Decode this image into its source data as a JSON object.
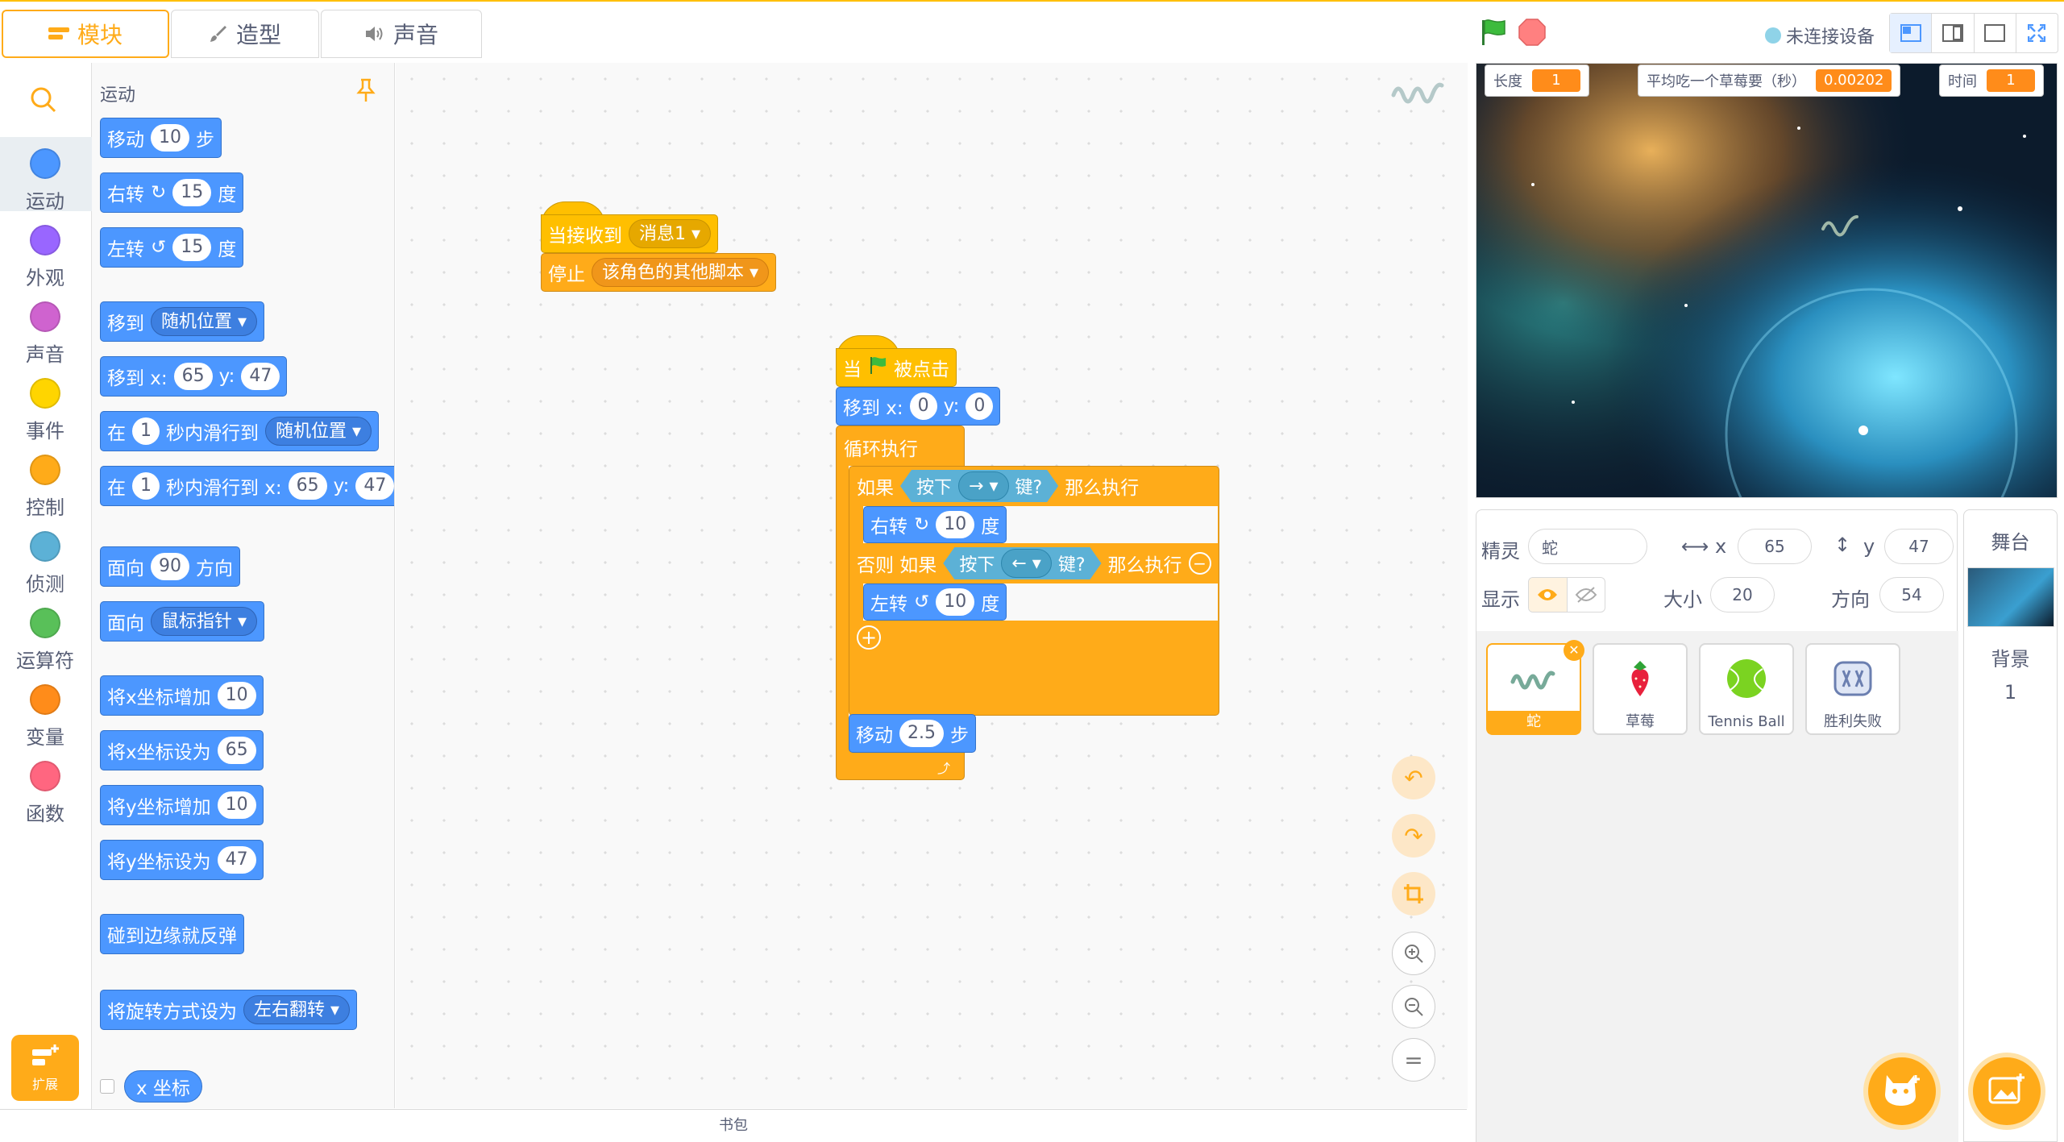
{
  "tabs": [
    {
      "label": "模块",
      "icon": "blocks-icon"
    },
    {
      "label": "造型",
      "icon": "brush-icon"
    },
    {
      "label": "声音",
      "icon": "speaker-icon"
    }
  ],
  "device_status": "未连接设备",
  "categories": [
    {
      "label": "运动",
      "color": "#4c97ff"
    },
    {
      "label": "外观",
      "color": "#9966ff"
    },
    {
      "label": "声音",
      "color": "#cf63cf"
    },
    {
      "label": "事件",
      "color": "#ffd500"
    },
    {
      "label": "控制",
      "color": "#ffab19"
    },
    {
      "label": "侦测",
      "color": "#5cb1d6"
    },
    {
      "label": "运算符",
      "color": "#59c059"
    },
    {
      "label": "变量",
      "color": "#ff8c1a"
    },
    {
      "label": "函数",
      "color": "#ff6680"
    }
  ],
  "extension_label": "扩展",
  "palette": {
    "section_title": "运动",
    "move": {
      "a": "移动",
      "n": "10",
      "b": "步"
    },
    "turn_right": {
      "a": "右转",
      "n": "15",
      "b": "度"
    },
    "turn_left": {
      "a": "左转",
      "n": "15",
      "b": "度"
    },
    "goto": {
      "a": "移到",
      "dd": "随机位置"
    },
    "goto_xy": {
      "a": "移到 x:",
      "x": "65",
      "b": "y:",
      "y": "47"
    },
    "glide": {
      "a": "在",
      "n": "1",
      "b": "秒内滑行到",
      "dd": "随机位置"
    },
    "glide_xy": {
      "a": "在",
      "n": "1",
      "b": "秒内滑行到 x:",
      "x": "65",
      "c": "y:",
      "y": "47"
    },
    "point_dir": {
      "a": "面向",
      "n": "90",
      "b": "方向"
    },
    "point_towards": {
      "a": "面向",
      "dd": "鼠标指针"
    },
    "change_x": {
      "a": "将x坐标增加",
      "n": "10"
    },
    "set_x": {
      "a": "将x坐标设为",
      "n": "65"
    },
    "change_y": {
      "a": "将y坐标增加",
      "n": "10"
    },
    "set_y": {
      "a": "将y坐标设为",
      "n": "47"
    },
    "bounce": "碰到边缘就反弹",
    "rotation": {
      "a": "将旋转方式设为",
      "dd": "左右翻转"
    },
    "xpos": "x 坐标"
  },
  "script1": {
    "hat": {
      "a": "当接收到",
      "dd": "消息1"
    },
    "stop": {
      "a": "停止",
      "dd": "该角色的其他脚本"
    }
  },
  "script2": {
    "hat": {
      "a": "当",
      "b": "被点击"
    },
    "goto": {
      "a": "移到 x:",
      "x": "0",
      "b": "y:",
      "y": "0"
    },
    "forever": "循环执行",
    "if1": {
      "a": "如果",
      "key": "按下",
      "keydd": "→",
      "keyq": "键?",
      "b": "那么执行"
    },
    "turn_r": {
      "a": "右转",
      "n": "10",
      "b": "度"
    },
    "elseif": {
      "a": "否则 如果",
      "key": "按下",
      "keydd": "←",
      "keyq": "键?",
      "b": "那么执行"
    },
    "turn_l": {
      "a": "左转",
      "n": "10",
      "b": "度"
    },
    "move": {
      "a": "移动",
      "n": "2.5",
      "b": "步"
    }
  },
  "backpack": "书包",
  "monitors": [
    {
      "label": "长度",
      "value": "1"
    },
    {
      "label": "平均吃一个草莓要（秒）",
      "value": "0.00202"
    },
    {
      "label": "时间",
      "value": "1"
    }
  ],
  "sprite_info": {
    "sprite_label": "精灵",
    "sprite_name": "蛇",
    "x_label": "x",
    "x": "65",
    "y_label": "y",
    "y": "47",
    "show_label": "显示",
    "size_label": "大小",
    "size": "20",
    "dir_label": "方向",
    "dir": "54"
  },
  "sprites": [
    {
      "name": "蛇",
      "icon": "snake-icon"
    },
    {
      "name": "草莓",
      "icon": "strawberry-icon"
    },
    {
      "name": "Tennis Ball",
      "icon": "tennis-ball-icon"
    },
    {
      "name": "胜利失败",
      "icon": "win-lose-icon"
    }
  ],
  "stage_panel": {
    "title": "舞台",
    "backdrop_label": "背景",
    "backdrop_count": "1"
  },
  "colors": {
    "accent": "#ffab19",
    "motion": "#4c97ff",
    "control": "#ffab19",
    "events": "#ffbf00",
    "sensing": "#5cb1d6"
  }
}
